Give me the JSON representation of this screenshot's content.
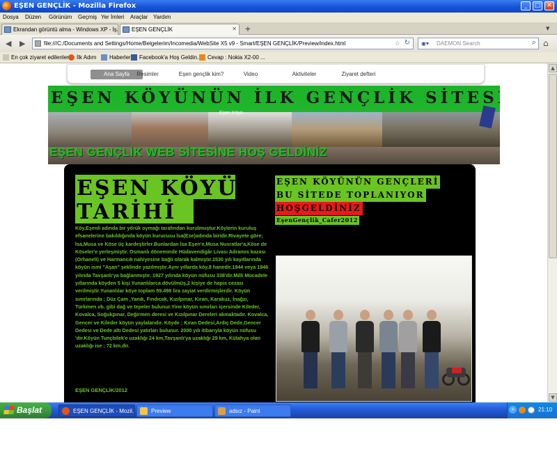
{
  "window": {
    "title": "EŞEN GENÇLİK - Mozilla Firefox",
    "minimize_glyph": "_",
    "maximize_glyph": "□",
    "close_glyph": "✕"
  },
  "menu": [
    "Dosya",
    "Düzen",
    "Görünüm",
    "Geçmiş",
    "Yer İmleri",
    "Araçlar",
    "Yardım"
  ],
  "tabs": [
    {
      "label": "Ekrandan görüntü alma - Windows XP - İş...",
      "active": false
    },
    {
      "label": "EŞEN GENÇLİK",
      "active": true
    }
  ],
  "new_tab_glyph": "+",
  "nav": {
    "url": "file:///C:/Documents and Settings/Home/Belgelerim/Incomedia/WebSite X5 v9 - Smart/EŞEN GENÇLİK/Preview/index.html",
    "search_placeholder": "DAEMON Search"
  },
  "bookmarks": [
    "En çok ziyaret edilenler",
    "İlk Adım",
    "Haberler",
    "Facebook'a Hoş Geldin...",
    "Cevap : Nokia X2-00 ..."
  ],
  "site": {
    "nav_items": [
      "Ana Sayfa",
      "Resimler",
      "Eşen gençlik kim?",
      "Video",
      "Aktiviteler",
      "Ziyaret defteri"
    ],
    "banner_title": "EŞEN KÖYÜNÜN İLK GENÇLİK SİTESİ",
    "banner_caption": "Eşen Köyü",
    "banner_welcome": "EŞEN GENÇLİK WEB SİTESİNE HOŞ GELDİNİZ",
    "left_heading_line1": "EŞEN KÖYÜ",
    "left_heading_line2": "TARİHİ",
    "history_text": "Köy,Eşenli adında bir yörük oymağı tarafından kurulmuştur.Köylerin kuruluş efsanelerine bakıldığında köyün kurucusu İsa(Ese)adında biridir.Rivayete göre; İsa,Musa ve Köse üç kardeştirler.Bunlardan İsa Eşen'e,Musa Nusratlar'a,Köse de Köseler'e yerleşmiştir. Osmanlı döneminde Hüdavendigâr Livası Adranos kazası (Orhaneli) ve Harmancık nahiyesine bağlı olarak kalmıştır.1530 yılı kayıtlarında köyün ismi \"Aşan\" şeklinde yazılmıştır.Aynı yıllarda köy,8 hanedir.1944 veya 1946 yılında Tavşanlı'ya bağlanmıştır. 1927 yılında köyün nüfusu 338'dir.Milli Mücadele yıllarında köyden 5 kişi Yunanlılarca dövülmüş,2 kişiye de hapis cezası verilmiştir.Yunanlılar köye toplam 59.498 lira zayiat verdirmişlerdir. Köyün sınırlarında ; Düz Çam ,Yanık, Fındıcak, Kızılpınar, Kıran, Karakuz, İnağzı, Türkmen vb. gibi dağ ve tepeler bulunur.Yine köyün sınırları içersinde Kileder, Kovalca, Soğukpınar, Değirmen deresi ve Kızılpınar Dereleri akmaktadır. Kovalca, Gencer ve Kileder köyün yaylalarıdır. Köyde ; Kıran Dedesi,Ardıç Dede,Gencer Dedesi ve Dede altı Dedesi yatırları bulunur. 2000 yılı itibarıyla köyün nüfusu 'dir.Köyün Tunçbilek'e uzaklığı 24 km,Tavşanlı'ya uzaklığı 29 km, Kütahya olan uzaklığı ise ; 72 km.dir.",
    "signature": "EŞEN GENÇLİK/2012",
    "right_line1": "EŞEN KÖYÜNÜN GENÇLERİ",
    "right_line2": "BU SİTEDE TOPLANIYOR",
    "right_line3": "HOŞGELDİNİZ",
    "right_line4": "EşenGençlik_Cafer2012"
  },
  "taskbar": {
    "start_label": "Başlat",
    "tasks": [
      {
        "label": "EŞEN GENÇLİK - Mozil...",
        "active": true
      },
      {
        "label": "Preview",
        "active": false
      },
      {
        "label": "adsız - Paint",
        "active": false
      }
    ],
    "clock": "21:10"
  },
  "colors": {
    "site_green": "#6ac423",
    "banner_green": "#14b51e",
    "highlight_red": "#e81a1a",
    "panel_black": "#000000"
  }
}
